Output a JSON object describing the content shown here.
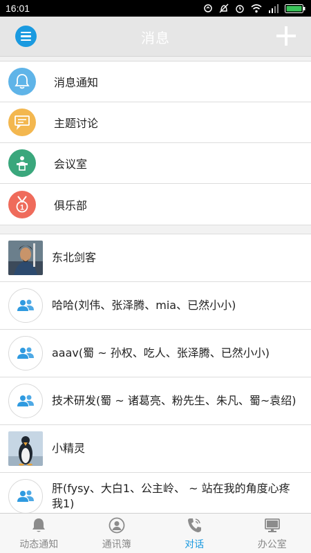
{
  "status_bar": {
    "time": "16:01",
    "icons": [
      "alarm-off-icon",
      "mute-icon",
      "alarm-clock-icon",
      "wifi-icon",
      "signal-icon",
      "battery-icon"
    ]
  },
  "header": {
    "title": "消息",
    "menu_icon": "menu-icon",
    "add_icon": "plus-icon"
  },
  "functions": [
    {
      "label": "消息通知",
      "icon": "bell-icon",
      "color": "#5fb4e8"
    },
    {
      "label": "主题讨论",
      "icon": "chat-bubble-icon",
      "color": "#f3b74f"
    },
    {
      "label": "会议室",
      "icon": "podium-icon",
      "color": "#3aa77c"
    },
    {
      "label": "俱乐部",
      "icon": "medal-icon",
      "color": "#ef6b5b"
    }
  ],
  "chats": [
    {
      "name": "东北剑客",
      "avatar": "photo-warrior"
    },
    {
      "name": "哈哈(刘伟、张泽腾、mia、已然小小)",
      "avatar": "group-icon"
    },
    {
      "name": "aaav(蜀 ~ 孙权、吃人、张泽腾、已然小小)",
      "avatar": "group-icon"
    },
    {
      "name": "技术研发(蜀 ~ 诸葛亮、粉先生、朱凡、蜀~袁绍)",
      "avatar": "group-icon"
    },
    {
      "name": "小精灵",
      "avatar": "photo-penguin"
    },
    {
      "name": "肝(fysy、大白1、公主岭、 ~ 站在我的角度心疼我1)",
      "avatar": "group-icon"
    }
  ],
  "bottom_nav": [
    {
      "label": "动态通知",
      "icon": "bell-icon",
      "active": false
    },
    {
      "label": "通讯簿",
      "icon": "contact-icon",
      "active": false
    },
    {
      "label": "对话",
      "icon": "phone-icon",
      "active": true
    },
    {
      "label": "办公室",
      "icon": "monitor-icon",
      "active": false
    }
  ],
  "colors": {
    "accent": "#1a9ae0",
    "header_bg": "#e6e6e6",
    "inactive": "#888888"
  }
}
